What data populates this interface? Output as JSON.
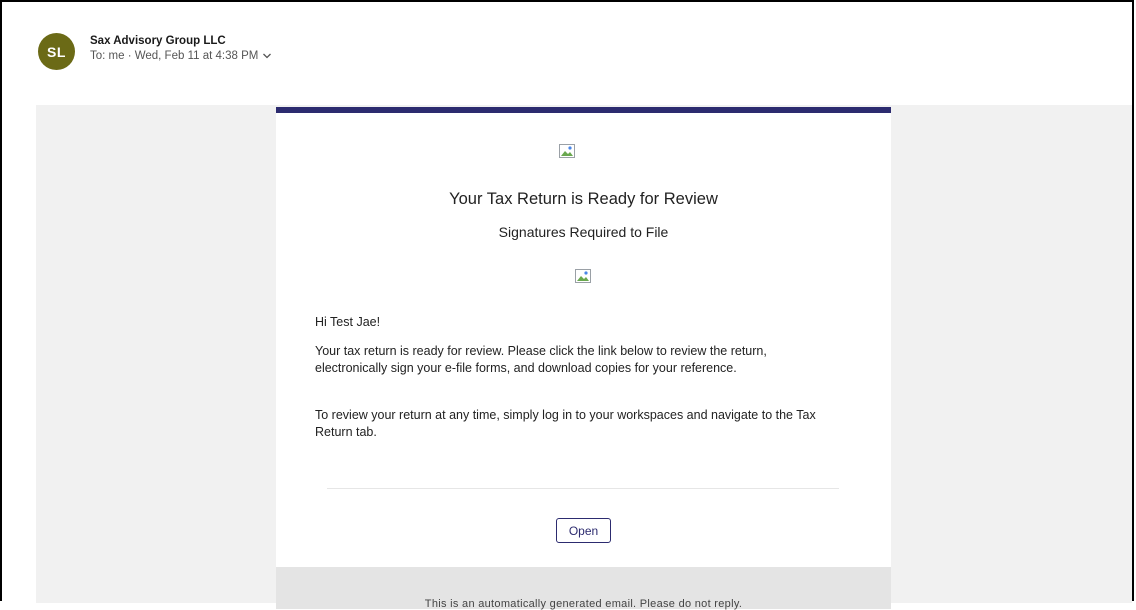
{
  "header": {
    "avatar_initials": "SL",
    "avatar_color": "#6b6a16",
    "sender_name": "Sax Advisory Group LLC",
    "meta": "To: me · Wed, Feb 11 at 4:38 PM",
    "details_icon": "chevron-down-icon"
  },
  "email": {
    "accent_color": "#2c2b6f",
    "logo_image": "broken-image-icon",
    "title": "Your Tax Return is Ready for Review",
    "subtitle": "Signatures Required to File",
    "banner_image": "broken-image-icon",
    "greeting": "Hi Test Jae!",
    "paragraph1": "Your tax return is ready for review. Please click the link below to review the return, electronically sign your e-file forms, and download copies for your reference.",
    "paragraph2": "To review your return at any time, simply log in to your workspaces and navigate to the Tax Return tab.",
    "open_button_label": "Open",
    "footer_text": "This is an automatically generated email. Please do not reply."
  }
}
